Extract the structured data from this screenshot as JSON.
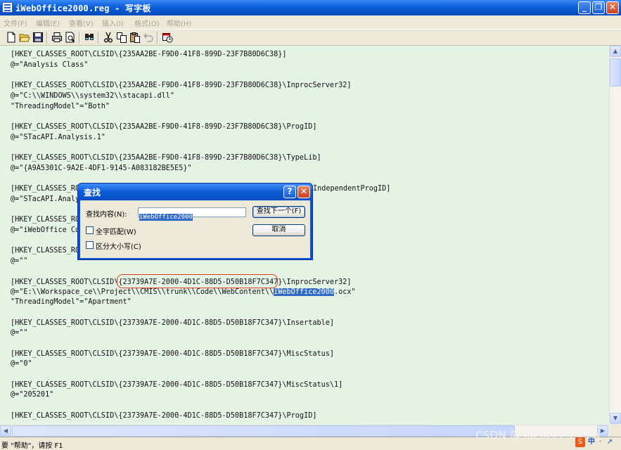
{
  "window": {
    "title": "iWebOffice2000.reg - 写字板",
    "buttons": [
      "_",
      "❐",
      "✕"
    ]
  },
  "menu": [
    "文件(F)",
    "编辑(E)",
    "查看(V)",
    "插入(I)",
    "格式(O)",
    "帮助(H)"
  ],
  "document": {
    "lines": [
      "[HKEY_CLASSES_ROOT\\CLSID\\{235AA2BE-F9D0-41F8-899D-23F7B80D6C38}]",
      "@=\"Analysis Class\"",
      "",
      "[HKEY_CLASSES_ROOT\\CLSID\\{235AA2BE-F9D0-41F8-899D-23F7B80D6C38}\\InprocServer32]",
      "@=\"C:\\\\WINDOWS\\\\system32\\\\stacapi.dll\"",
      "\"ThreadingModel\"=\"Both\"",
      "",
      "[HKEY_CLASSES_ROOT\\CLSID\\{235AA2BE-F9D0-41F8-899D-23F7B80D6C38}\\ProgID]",
      "@=\"STacAPI.Analysis.1\"",
      "",
      "[HKEY_CLASSES_ROOT\\CLSID\\{235AA2BE-F9D0-41F8-899D-23F7B80D6C38}\\TypeLib]",
      "@=\"{A9A5301C-9A2E-4DF1-9145-A083182BE5E5}\"",
      "",
      "[HKEY_CLASSES_ROO",
      "@=\"STacAPI.Analy",
      "",
      "[HKEY_CLASSES_RO",
      "@=\"iWebOffice Co",
      "",
      "[HKEY_CLASSES_RO",
      "@=\"\"",
      "",
      "[HKEY_CLASSES_ROOT\\CLSID\\{23739A7E-2000-4D1C-88D5-D50B18F7C347}\\InprocServer32]",
      "@=\"E:\\\\Workspace_ce\\\\Project\\\\CMIS\\\\trunk\\\\Code\\\\WebContent\\\\iWebOffice2000.ocx\"",
      "\"ThreadingModel\"=\"Apartment\"",
      "",
      "[HKEY_CLASSES_ROOT\\CLSID\\{23739A7E-2000-4D1C-88D5-D50B18F7C347}\\Insertable]",
      "@=\"\"",
      "",
      "[HKEY_CLASSES_ROOT\\CLSID\\{23739A7E-2000-4D1C-88D5-D50B18F7C347}\\MiscStatus]",
      "@=\"0\"",
      "",
      "[HKEY_CLASSES_ROOT\\CLSID\\{23739A7E-2000-4D1C-88D5-D50B18F7C347}\\MiscStatus\\1]",
      "@=\"205201\"",
      "",
      "[HKEY_CLASSES_ROOT\\CLSID\\{23739A7E-2000-4D1C-88D5-D50B18F7C347}\\ProgID]"
    ],
    "obscured_right_fragment": "IndependentProgID]",
    "highlight_line_prefix": "@=\"E:\\\\Workspace_ce\\\\Project\\\\CMIS\\\\trunk\\\\Code\\\\WebContent\\\\",
    "highlight_match": "iWebOffice2000",
    "highlight_line_suffix": ".ocx\"",
    "circled_line_prefix": "[HKEY_CLASSES_ROOT\\CLSID\\",
    "circled_guid": "{23739A7E-2000-4D1C-88D5-D50B18F7C347}",
    "circled_line_suffix": "\\InprocServer32]"
  },
  "find_dialog": {
    "title": "查找",
    "help_button": "?",
    "close_button": "✕",
    "find_label": "查找内容(N):",
    "find_value": "iWebOffice2000",
    "find_next_button": "查找下一个(F)",
    "cancel_button": "取消",
    "match_whole_word": "全字匹配(W)",
    "match_case": "区分大小写(C)"
  },
  "status": {
    "text": "要 \"帮助\"，请按 F1"
  },
  "watermark": "CSDN @spencer_tseng",
  "tray_icons": [
    "S",
    "中",
    "·",
    "↗"
  ]
}
